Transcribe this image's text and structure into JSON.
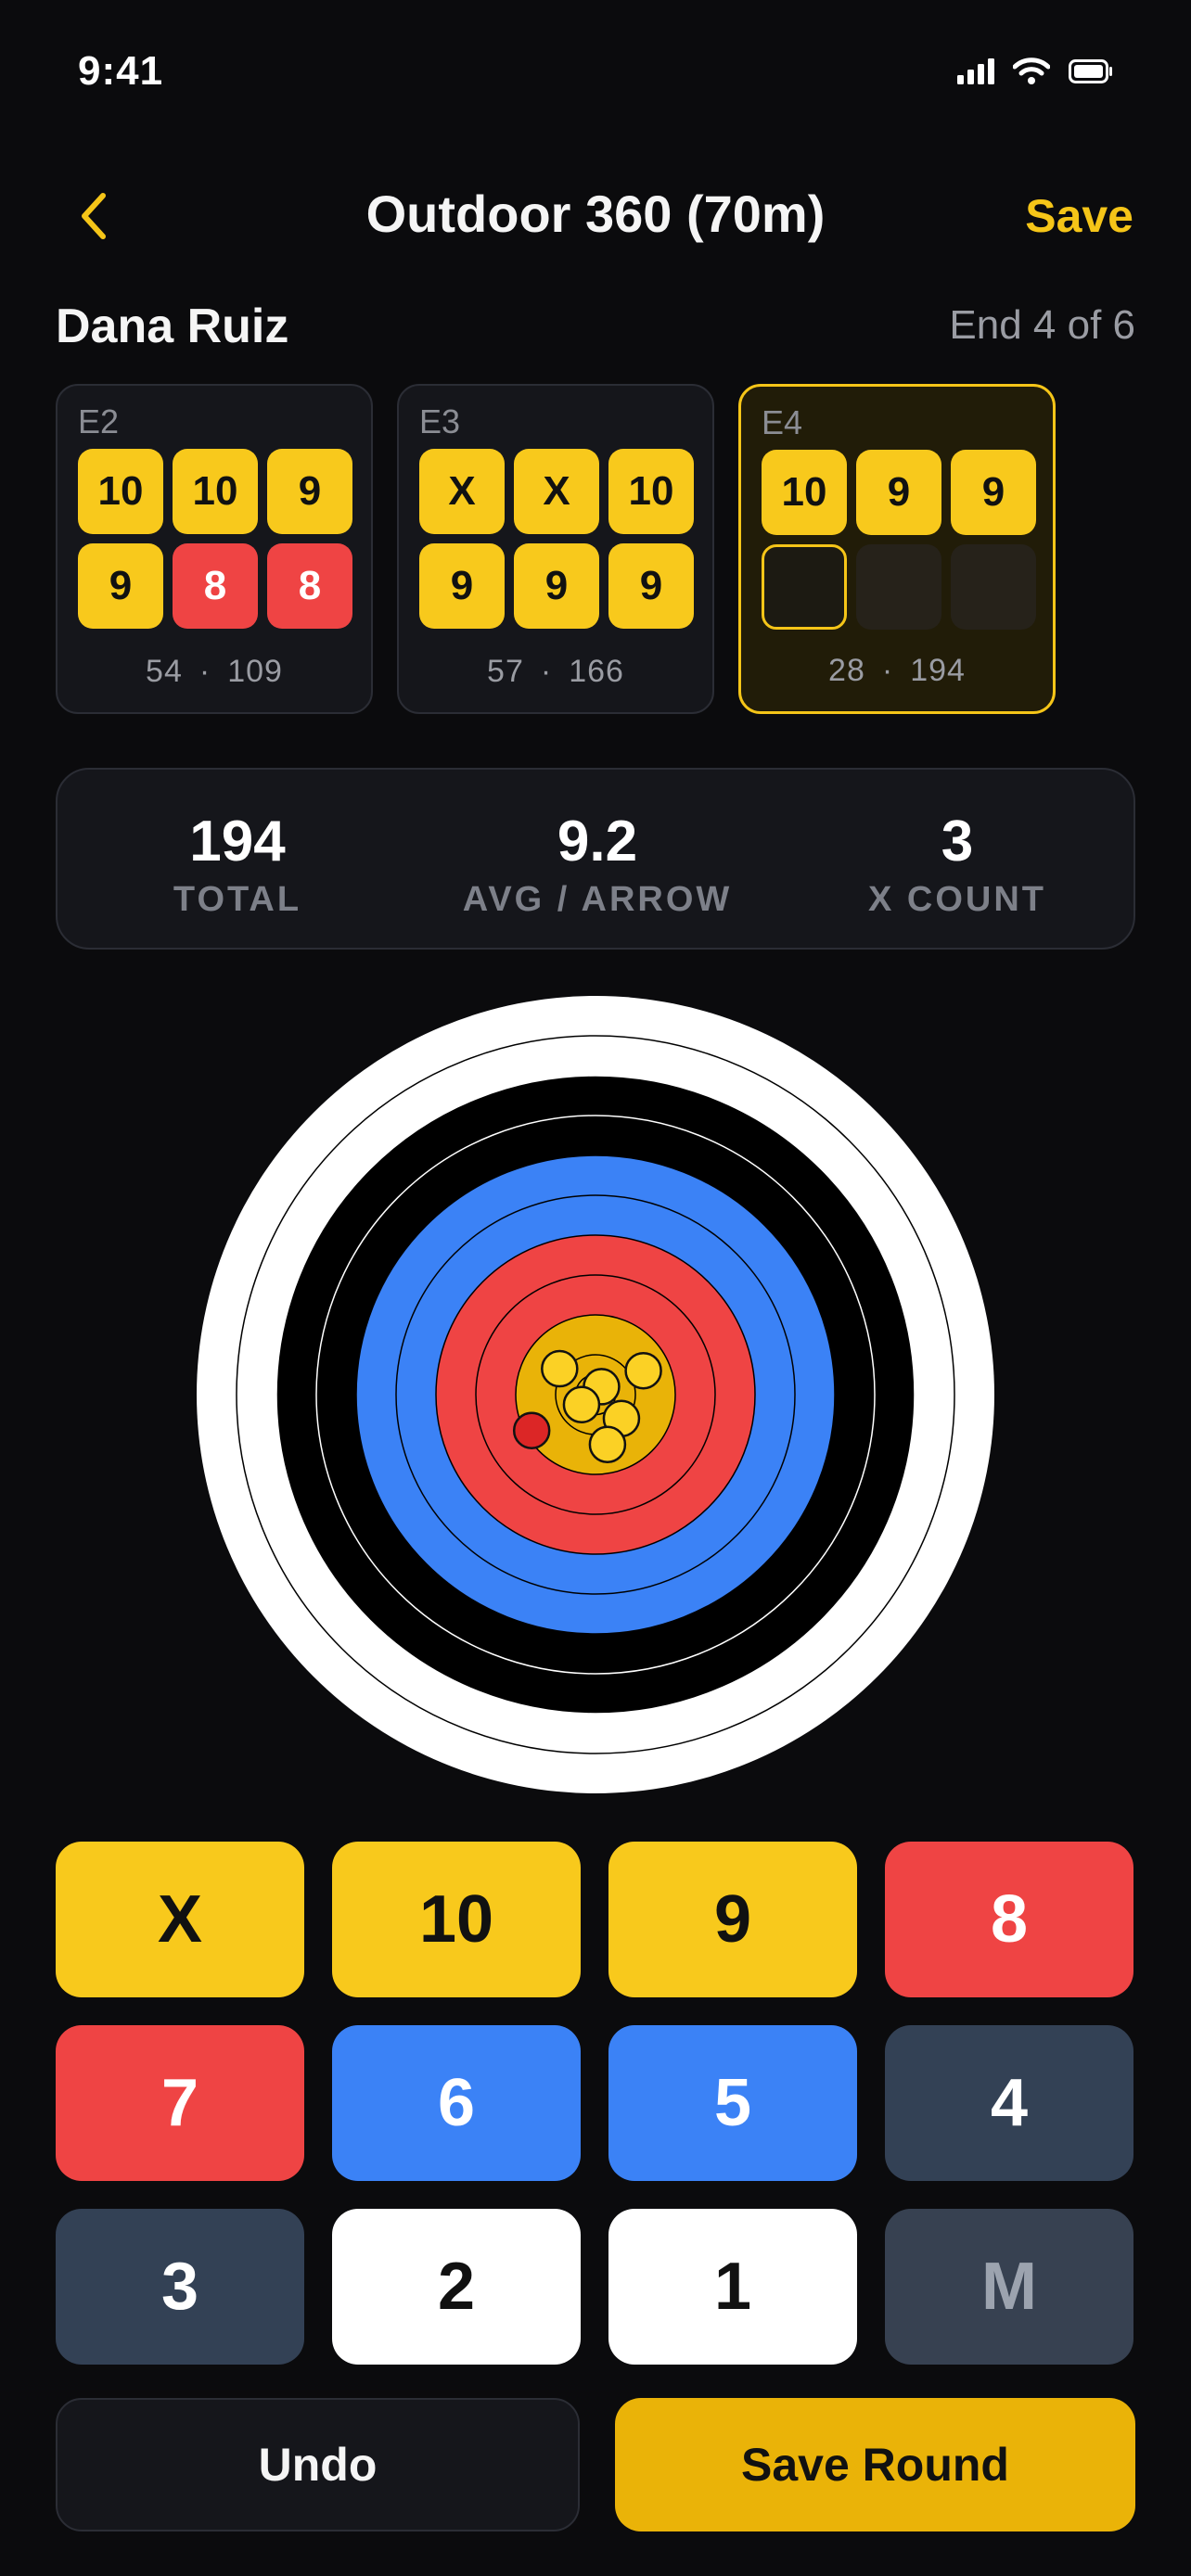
{
  "status_bar": {
    "time": "9:41",
    "icons": [
      "signal-icon",
      "wifi-icon",
      "battery-icon"
    ]
  },
  "nav": {
    "back_icon": "chevron-left-icon",
    "title": "Outdoor 360 (70m)",
    "save_label": "Save"
  },
  "archer": {
    "name": "Dana Ruiz",
    "end_progress": "End 4 of 6"
  },
  "ends": [
    {
      "label": "E2",
      "arrows": [
        {
          "value": "10",
          "color": "gold"
        },
        {
          "value": "10",
          "color": "gold"
        },
        {
          "value": "9",
          "color": "gold"
        },
        {
          "value": "9",
          "color": "gold"
        },
        {
          "value": "8",
          "color": "red"
        },
        {
          "value": "8",
          "color": "red"
        }
      ],
      "end_total": "54",
      "separator": "·",
      "running_total": "109",
      "active": false
    },
    {
      "label": "E3",
      "arrows": [
        {
          "value": "X",
          "color": "gold"
        },
        {
          "value": "X",
          "color": "gold"
        },
        {
          "value": "10",
          "color": "gold"
        },
        {
          "value": "9",
          "color": "gold"
        },
        {
          "value": "9",
          "color": "gold"
        },
        {
          "value": "9",
          "color": "gold"
        }
      ],
      "end_total": "57",
      "separator": "·",
      "running_total": "166",
      "active": false
    },
    {
      "label": "E4",
      "arrows": [
        {
          "value": "10",
          "color": "gold"
        },
        {
          "value": "9",
          "color": "gold"
        },
        {
          "value": "9",
          "color": "gold"
        },
        {
          "value": "",
          "color": "current"
        },
        {
          "value": "",
          "color": "empty"
        },
        {
          "value": "",
          "color": "empty"
        }
      ],
      "end_total": "28",
      "separator": "·",
      "running_total": "194",
      "active": true
    }
  ],
  "stats": {
    "total": {
      "value": "194",
      "label": "TOTAL"
    },
    "average": {
      "value": "9.2",
      "label": "AVG / ARROW"
    },
    "x_count": {
      "value": "3",
      "label": "X COUNT"
    }
  },
  "target": {
    "ring_colors": {
      "white": "#ffffff",
      "black": "#000000",
      "blue": "#3b82f6",
      "red": "#ef4444",
      "gold": "#e9b308",
      "marker_gold": "#fbd125",
      "marker_red": "#dc2626"
    },
    "arrow_marks": [
      {
        "dx": -0.18,
        "dy": -0.13,
        "color": "gold"
      },
      {
        "dx": 0.24,
        "dy": -0.12,
        "color": "gold"
      },
      {
        "dx": 0.03,
        "dy": -0.04,
        "color": "gold"
      },
      {
        "dx": -0.07,
        "dy": 0.05,
        "color": "gold"
      },
      {
        "dx": 0.13,
        "dy": 0.12,
        "color": "gold"
      },
      {
        "dx": 0.06,
        "dy": 0.25,
        "color": "gold"
      },
      {
        "dx": -0.32,
        "dy": 0.18,
        "color": "red"
      }
    ]
  },
  "keypad": [
    {
      "label": "X",
      "style": "gold"
    },
    {
      "label": "10",
      "style": "gold"
    },
    {
      "label": "9",
      "style": "gold"
    },
    {
      "label": "8",
      "style": "red"
    },
    {
      "label": "7",
      "style": "red"
    },
    {
      "label": "6",
      "style": "blue"
    },
    {
      "label": "5",
      "style": "blue"
    },
    {
      "label": "4",
      "style": "slate"
    },
    {
      "label": "3",
      "style": "slate"
    },
    {
      "label": "2",
      "style": "white"
    },
    {
      "label": "1",
      "style": "white"
    },
    {
      "label": "M",
      "style": "miss"
    }
  ],
  "actions": {
    "undo_label": "Undo",
    "save_round_label": "Save Round"
  }
}
